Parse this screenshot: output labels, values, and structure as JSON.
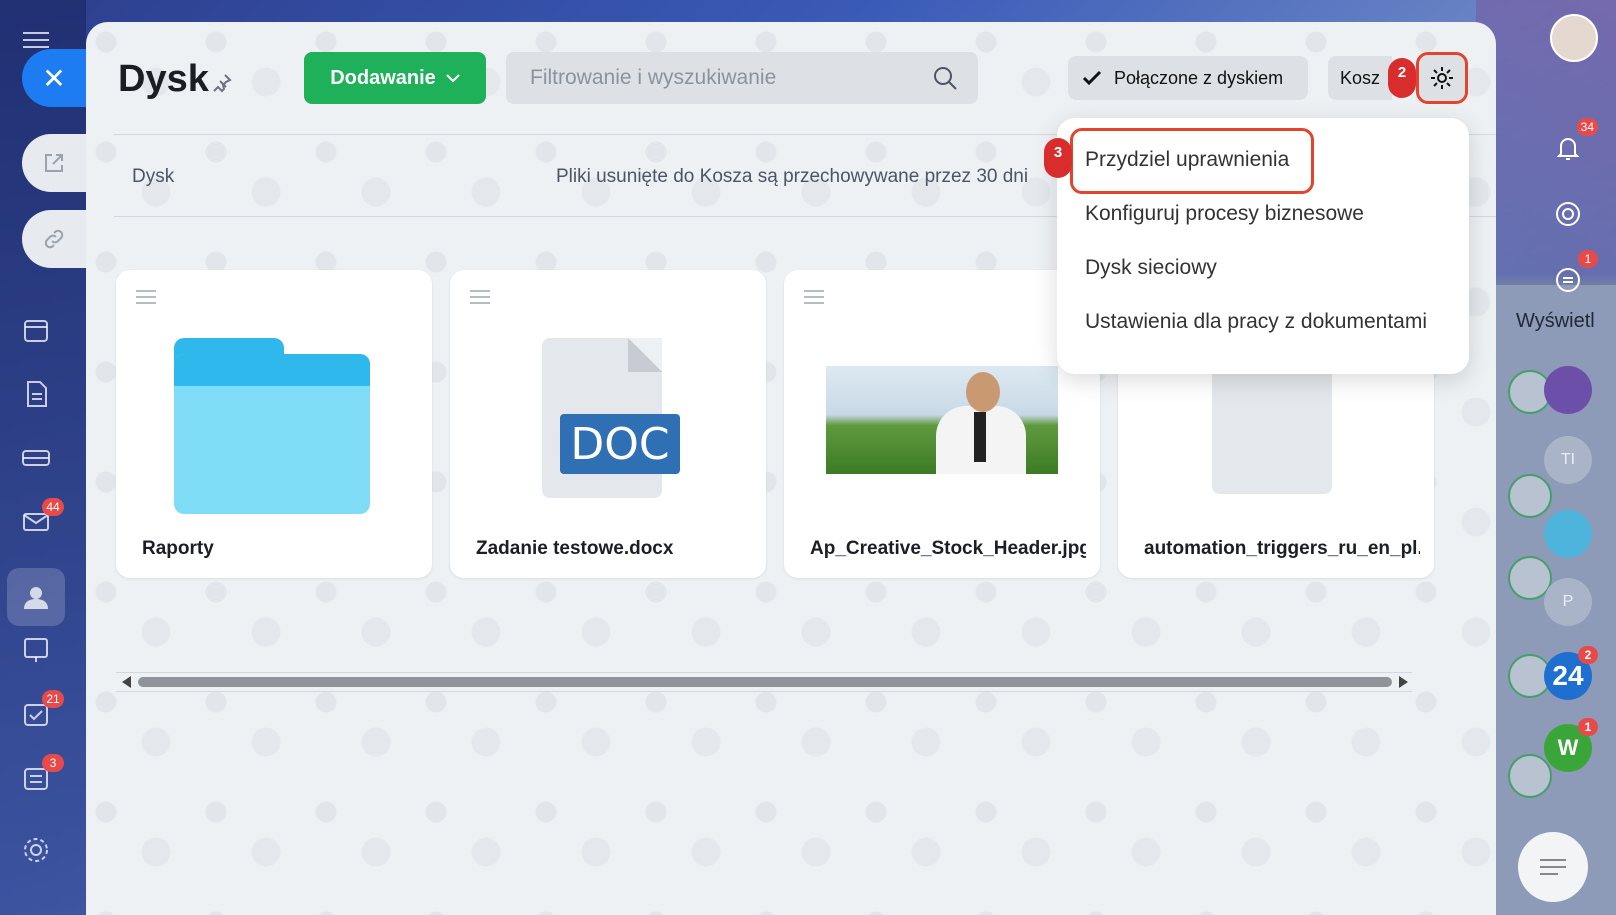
{
  "left_rail": {
    "badges": {
      "mail": "44",
      "tasks": "21",
      "feed": "3"
    }
  },
  "right_rail": {
    "notifications_badge": "34",
    "chat_badge": "1",
    "b24_label": "24",
    "b24_badge": "2",
    "w_label": "W",
    "w_badge": "1",
    "ti_label": "TI",
    "p_label": "P",
    "wyswietl": "Wyświetl"
  },
  "header": {
    "title": "Dysk",
    "add_button": "Dodawanie",
    "search_placeholder": "Filtrowanie i wyszukiwanie",
    "connected_label": "Połączone z dyskiem",
    "trash_label": "Kosz",
    "step2": "2"
  },
  "breadcrumb": "Dysk",
  "info_text": "Pliki usunięte do Kosza są przechowywane przez 30 dni",
  "files": [
    {
      "name": "Raporty",
      "type": "folder"
    },
    {
      "name": "Zadanie testowe.docx",
      "type": "doc",
      "icon_label": "DOC"
    },
    {
      "name": "Ap_Creative_Stock_Header.jpg",
      "type": "image"
    },
    {
      "name": "automation_triggers_ru_en_pl....",
      "type": "file"
    }
  ],
  "menu": {
    "step3": "3",
    "items": [
      "Przydziel uprawnienia",
      "Konfiguruj procesy biznesowe",
      "Dysk sieciowy",
      "Ustawienia dla pracy z dokumentami"
    ]
  },
  "colors": {
    "accent_green": "#1fb05a",
    "highlight_red": "#e2452b",
    "badge_red": "#d92d2d",
    "close_blue": "#1d7cf2"
  }
}
